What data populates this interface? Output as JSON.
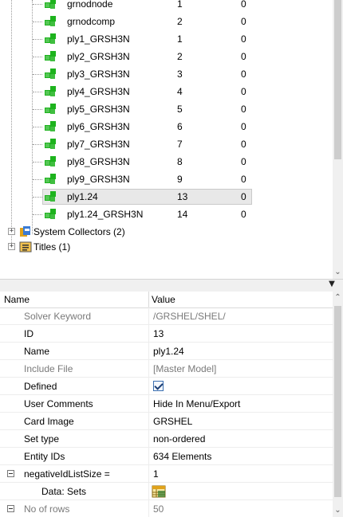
{
  "tree": {
    "items": [
      {
        "name": "grnodnode",
        "id": "1",
        "col": "0"
      },
      {
        "name": "grnodcomp",
        "id": "2",
        "col": "0"
      },
      {
        "name": "ply1_GRSH3N",
        "id": "1",
        "col": "0"
      },
      {
        "name": "ply2_GRSH3N",
        "id": "2",
        "col": "0"
      },
      {
        "name": "ply3_GRSH3N",
        "id": "3",
        "col": "0"
      },
      {
        "name": "ply4_GRSH3N",
        "id": "4",
        "col": "0"
      },
      {
        "name": "ply5_GRSH3N",
        "id": "5",
        "col": "0"
      },
      {
        "name": "ply6_GRSH3N",
        "id": "6",
        "col": "0"
      },
      {
        "name": "ply7_GRSH3N",
        "id": "7",
        "col": "0"
      },
      {
        "name": "ply8_GRSH3N",
        "id": "8",
        "col": "0"
      },
      {
        "name": "ply9_GRSH3N",
        "id": "9",
        "col": "0"
      },
      {
        "name": "ply1.24",
        "id": "13",
        "col": "0",
        "selected": true
      },
      {
        "name": "ply1.24_GRSH3N",
        "id": "14",
        "col": "0"
      }
    ],
    "collectors": [
      {
        "label": "System Collectors (2)",
        "icon": "system-collectors-icon",
        "expander": "+"
      },
      {
        "label": "Titles (1)",
        "icon": "titles-icon",
        "expander": "+"
      }
    ],
    "item_icon": "set-icon",
    "item_icon_color": "#1db31d"
  },
  "grid": {
    "header": {
      "name": "Name",
      "value": "Value"
    },
    "rows": [
      {
        "name": "Solver Keyword",
        "value": "/GRSHEL/SHEL/",
        "gray": true
      },
      {
        "name": "ID",
        "value": "13"
      },
      {
        "name": "Name",
        "value": "ply1.24"
      },
      {
        "name": "Include File",
        "value": "[Master Model]",
        "gray": true
      },
      {
        "name": "Defined",
        "value": "",
        "type": "checkbox",
        "checked": true
      },
      {
        "name": "User Comments",
        "value": "Hide In Menu/Export"
      },
      {
        "name": "Card Image",
        "value": "GRSHEL"
      },
      {
        "name": "Set type",
        "value": "non-ordered"
      },
      {
        "name": "Entity IDs",
        "value": "634 Elements"
      },
      {
        "name": "negativeIdListSize =",
        "value": "1",
        "expander": "−"
      },
      {
        "name": "Data: Sets",
        "value": "",
        "type": "data-icon",
        "indent": true
      },
      {
        "name": "No of rows",
        "value": "50",
        "gray": true,
        "expander": "−"
      }
    ]
  }
}
